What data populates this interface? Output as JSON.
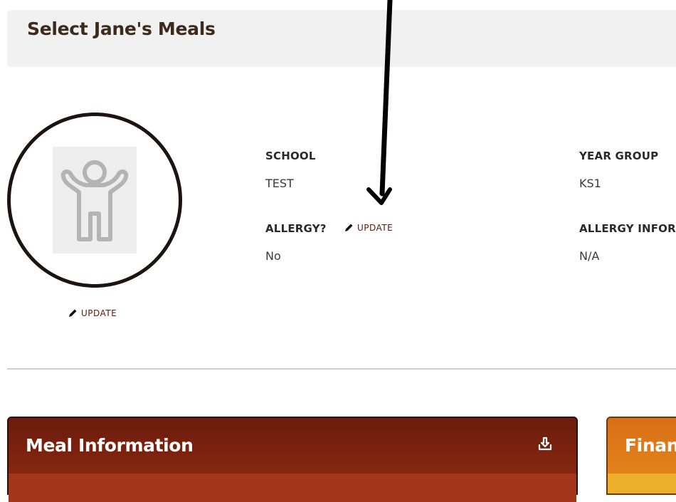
{
  "header": {
    "title": "Select Jane's Meals"
  },
  "profile": {
    "avatar_icon": "child-silhouette-icon",
    "update_label": "UPDATE"
  },
  "fields": {
    "school": {
      "label": "SCHOOL",
      "value": "TEST"
    },
    "year_group": {
      "label": "YEAR GROUP",
      "value": "KS1"
    },
    "allergy": {
      "label": "ALLERGY?",
      "value": "No",
      "update_label": "UPDATE"
    },
    "allergy_info": {
      "label": "ALLERGY INFORMATION",
      "value": "N/A"
    }
  },
  "panels": {
    "meal": {
      "title": "Meal Information",
      "icon": "download-icon",
      "color": "#7a2210"
    },
    "finance": {
      "title": "Finance",
      "color": "#de7a18"
    }
  },
  "annotation": {
    "icon": "arrow-down-icon"
  }
}
